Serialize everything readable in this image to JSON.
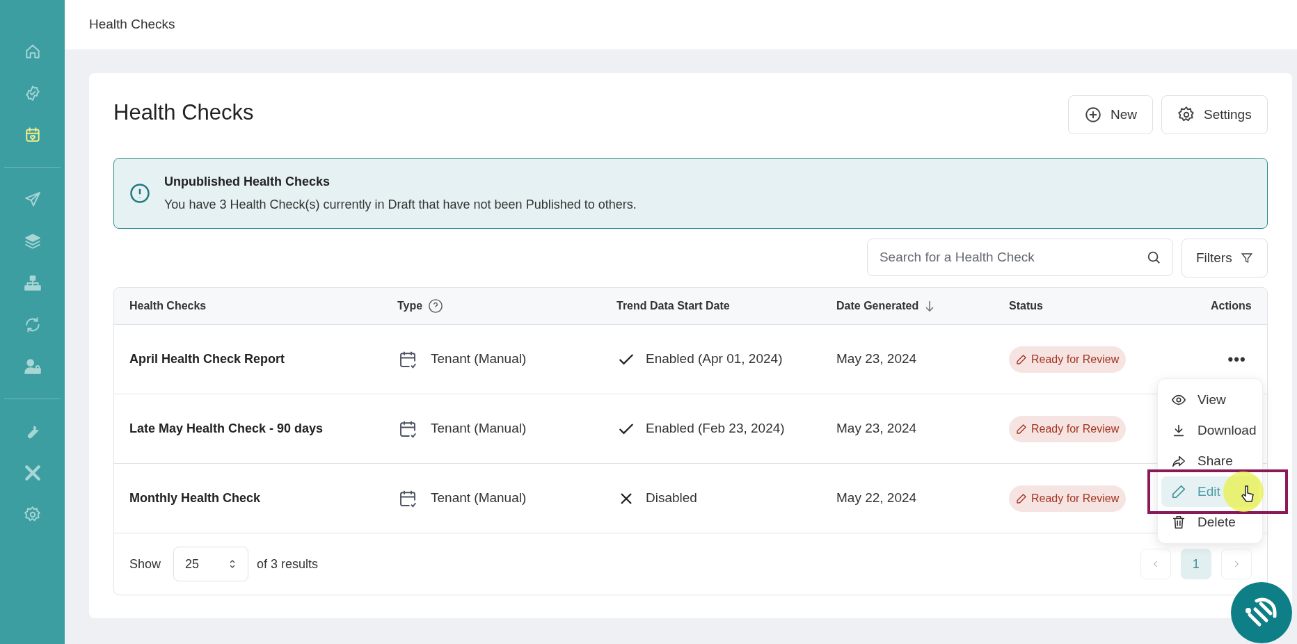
{
  "sidebar": {
    "groups": [
      [
        {
          "selected": false
        },
        {
          "selected": false
        },
        {
          "selected": true
        }
      ],
      [
        {
          "selected": false
        },
        {
          "selected": false
        },
        {
          "selected": false
        },
        {
          "selected": false
        },
        {
          "selected": false
        }
      ],
      [
        {
          "selected": false
        },
        {
          "selected": false
        },
        {
          "selected": false
        }
      ]
    ]
  },
  "header": {
    "title": "Health Checks"
  },
  "page": {
    "title": "Health Checks",
    "buttons": [
      {
        "label": "New"
      },
      {
        "label": "Settings"
      }
    ]
  },
  "banner": {
    "title": "Unpublished Health Checks",
    "message": "You have 3 Health Check(s) currently in Draft that have not been Published to others."
  },
  "search": {
    "placeholder": "Search for a Health Check"
  },
  "filters": {
    "label": "Filters"
  },
  "table": {
    "columns": [
      {
        "label": "Health Checks"
      },
      {
        "label": "Type"
      },
      {
        "label": "Trend Data Start Date"
      },
      {
        "label": "Date Generated"
      },
      {
        "label": "Status"
      },
      {
        "label": "Actions"
      }
    ],
    "rows": [
      {
        "name": "April Health Check Report",
        "type": "Tenant (Manual)",
        "trend_enabled": true,
        "trend": "Enabled (Apr 01, 2024)",
        "date": "May 23, 2024",
        "status": "Ready for Review",
        "actions": "•••"
      },
      {
        "name": "Late May Health Check - 90 days",
        "type": "Tenant (Manual)",
        "trend_enabled": true,
        "trend": "Enabled (Feb 23, 2024)",
        "date": "May 23, 2024",
        "status": "Ready for Review"
      },
      {
        "name": "Monthly Health Check",
        "type": "Tenant (Manual)",
        "trend_enabled": false,
        "trend": "Disabled",
        "date": "May 22, 2024",
        "status": "Ready for Review"
      }
    ]
  },
  "footer": {
    "show_label": "Show",
    "page_size": "25",
    "results": "of 3 results",
    "pages": [
      {
        "label": "1",
        "selected": true
      }
    ]
  },
  "menu": {
    "items": [
      {
        "label": "View",
        "highlighted": false
      },
      {
        "label": "Download",
        "highlighted": false
      },
      {
        "label": "Share",
        "highlighted": false
      },
      {
        "label": "Edit",
        "highlighted": true
      },
      {
        "label": "Delete",
        "highlighted": false
      }
    ]
  }
}
